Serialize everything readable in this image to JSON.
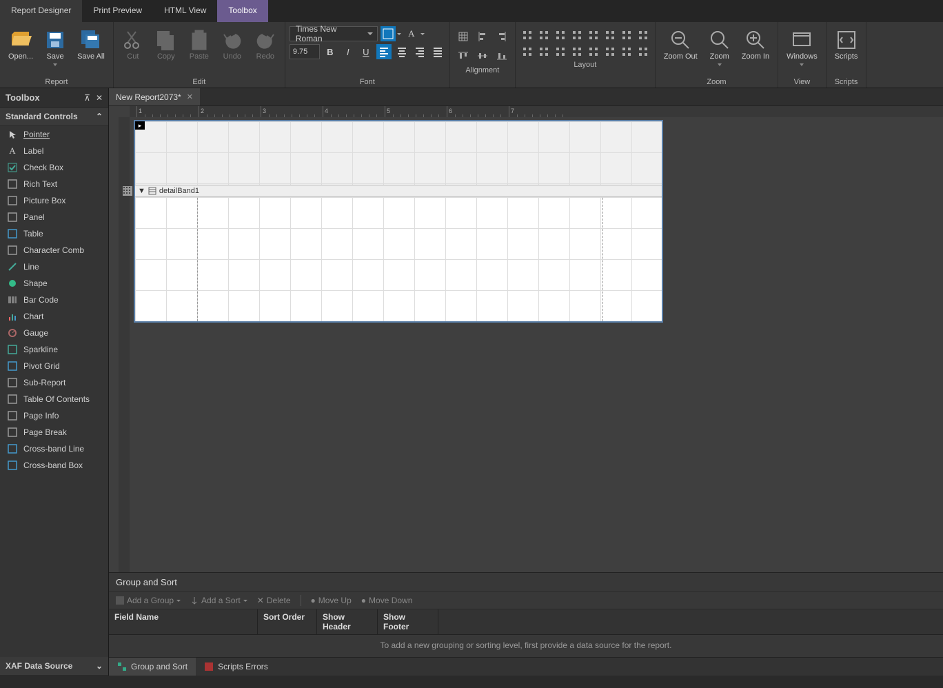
{
  "top_tabs": {
    "report_designer": "Report Designer",
    "print_preview": "Print Preview",
    "html_view": "HTML View",
    "toolbox": "Toolbox"
  },
  "ribbon": {
    "report": {
      "label": "Report",
      "open": "Open...",
      "save": "Save",
      "save_all": "Save All"
    },
    "edit": {
      "label": "Edit",
      "cut": "Cut",
      "copy": "Copy",
      "paste": "Paste",
      "undo": "Undo",
      "redo": "Redo"
    },
    "font": {
      "label": "Font",
      "family": "Times New Roman",
      "size": "9.75"
    },
    "alignment": {
      "label": "Alignment"
    },
    "layout": {
      "label": "Layout"
    },
    "zoom": {
      "label": "Zoom",
      "zoom_out": "Zoom Out",
      "zoom": "Zoom",
      "zoom_in": "Zoom In"
    },
    "view": {
      "label": "View",
      "windows": "Windows"
    },
    "scripts": {
      "label": "Scripts",
      "scripts": "Scripts"
    }
  },
  "toolbox": {
    "title": "Toolbox",
    "section_standard": "Standard Controls",
    "section_xaf": "XAF Data Source",
    "items": [
      {
        "label": "Pointer",
        "icon": "pointer"
      },
      {
        "label": "Label",
        "icon": "label"
      },
      {
        "label": "Check Box",
        "icon": "checkbox"
      },
      {
        "label": "Rich Text",
        "icon": "richtext"
      },
      {
        "label": "Picture Box",
        "icon": "picturebox"
      },
      {
        "label": "Panel",
        "icon": "panel"
      },
      {
        "label": "Table",
        "icon": "table"
      },
      {
        "label": "Character Comb",
        "icon": "charcomb"
      },
      {
        "label": "Line",
        "icon": "line"
      },
      {
        "label": "Shape",
        "icon": "shape"
      },
      {
        "label": "Bar Code",
        "icon": "barcode"
      },
      {
        "label": "Chart",
        "icon": "chart"
      },
      {
        "label": "Gauge",
        "icon": "gauge"
      },
      {
        "label": "Sparkline",
        "icon": "sparkline"
      },
      {
        "label": "Pivot Grid",
        "icon": "pivotgrid"
      },
      {
        "label": "Sub-Report",
        "icon": "subreport"
      },
      {
        "label": "Table Of Contents",
        "icon": "toc"
      },
      {
        "label": "Page Info",
        "icon": "pageinfo"
      },
      {
        "label": "Page Break",
        "icon": "pagebreak"
      },
      {
        "label": "Cross-band Line",
        "icon": "crossbandline"
      },
      {
        "label": "Cross-band Box",
        "icon": "crossbandbox"
      }
    ]
  },
  "doc": {
    "tab_label": "New Report2073*",
    "detail_band": "detailBand1"
  },
  "ruler_numbers": [
    "1",
    "2",
    "3",
    "4",
    "5",
    "6",
    "7"
  ],
  "group_sort": {
    "title": "Group and Sort",
    "add_group": "Add a Group",
    "add_sort": "Add a Sort",
    "delete": "Delete",
    "move_up": "Move Up",
    "move_down": "Move Down",
    "cols": {
      "field_name": "Field Name",
      "sort_order": "Sort Order",
      "show_header": "Show Header",
      "show_footer": "Show Footer"
    },
    "empty_msg": "To add a new grouping or sorting level, first provide a data source for the report."
  },
  "bottom_tabs": {
    "group_sort": "Group and Sort",
    "scripts_errors": "Scripts Errors"
  },
  "status": ""
}
